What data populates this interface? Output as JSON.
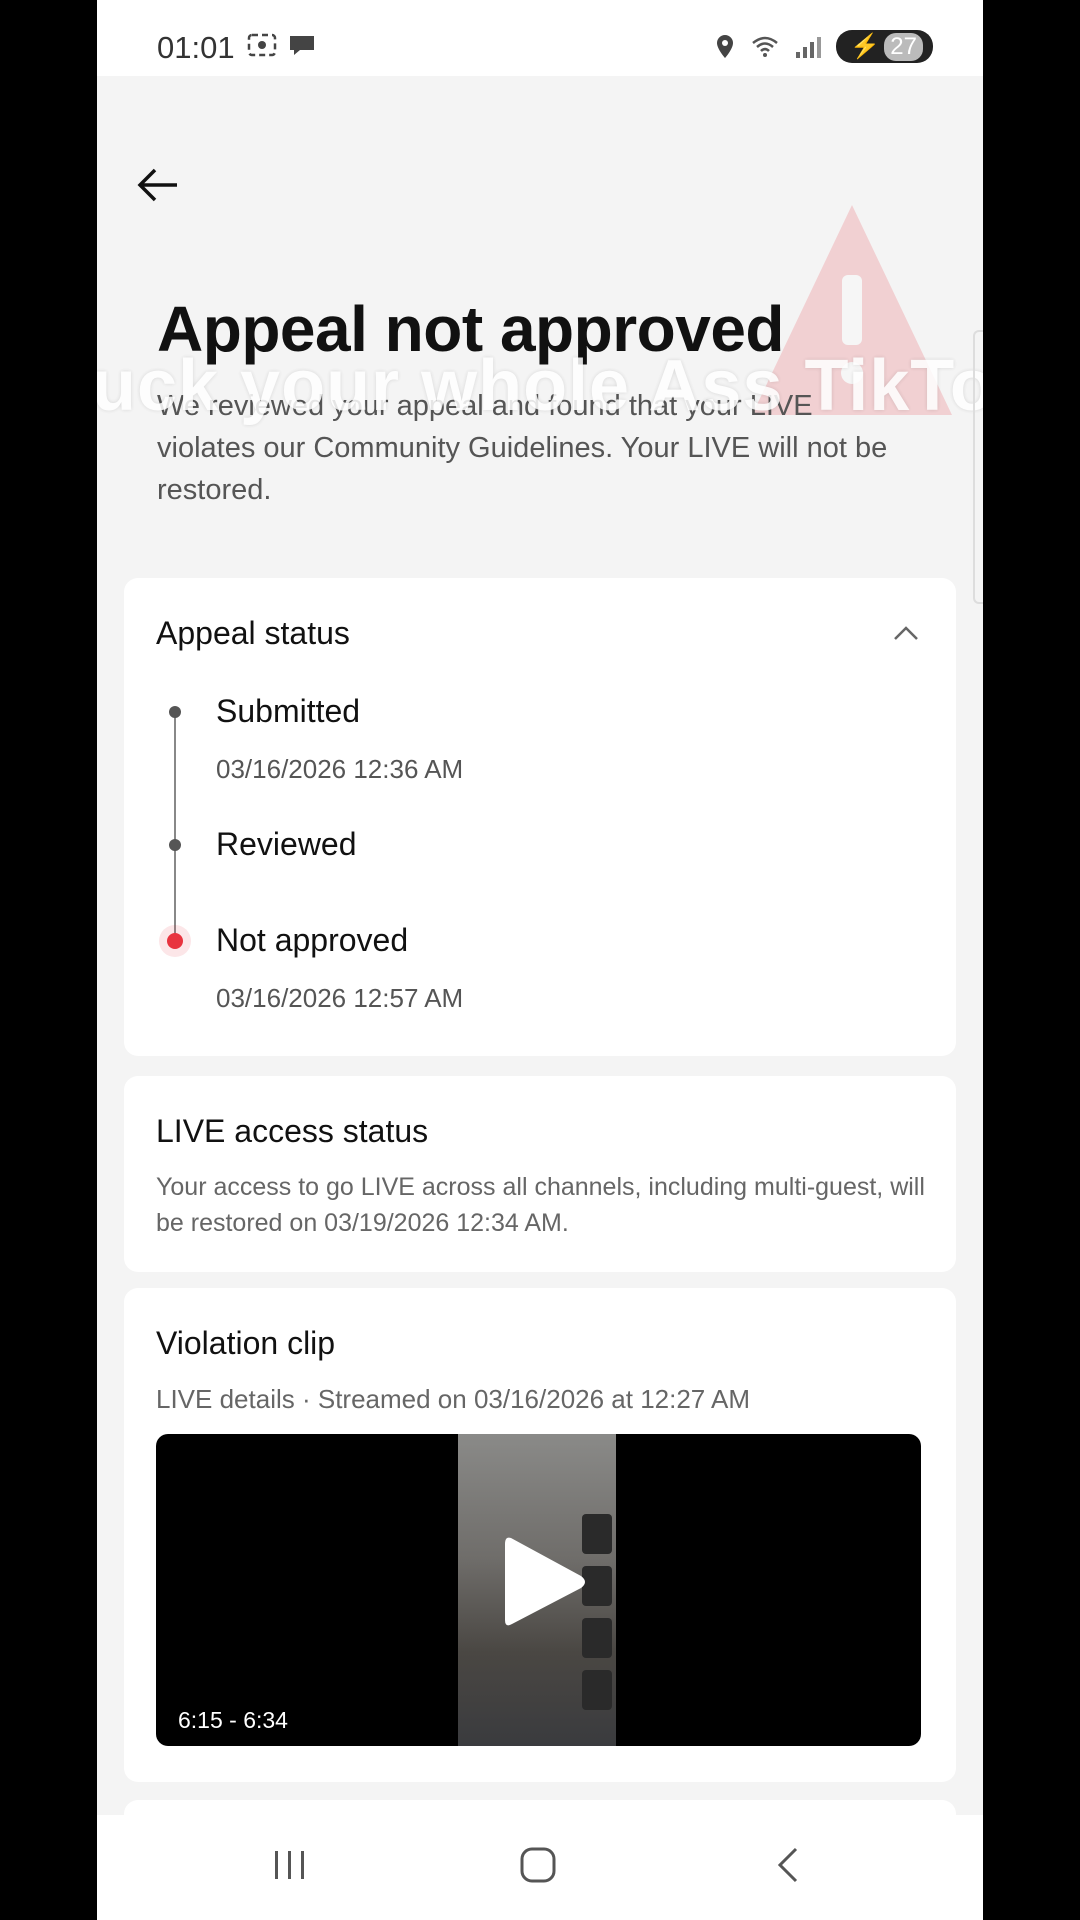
{
  "status_bar": {
    "time": "01:01",
    "battery": "27",
    "icons_left": [
      "screen-record-icon",
      "chat-bubble-icon"
    ],
    "icons_right": [
      "location-icon",
      "wifi-icon",
      "signal-icon",
      "battery-icon"
    ]
  },
  "overlay_caption": "Fuck your whole Ass TikTok",
  "header": {
    "title": "Appeal not approved",
    "description": "We reviewed your appeal and found that your LIVE violates our Community Guidelines. Your LIVE will not be restored."
  },
  "appeal_status": {
    "title": "Appeal status",
    "steps": [
      {
        "label": "Submitted",
        "date": "03/16/2026 12:36 AM"
      },
      {
        "label": "Reviewed",
        "date": ""
      },
      {
        "label": "Not approved",
        "date": "03/16/2026 12:57 AM"
      }
    ]
  },
  "live_access": {
    "title": "LIVE access status",
    "text": "Your access to go LIVE across all channels, including multi-guest, will be restored on 03/19/2026 12:34 AM."
  },
  "violation_clip": {
    "title": "Violation clip",
    "subtitle": "LIVE details · Streamed on 03/16/2026 at 12:27 AM",
    "time_range": "6:15 - 6:34"
  },
  "colors": {
    "accent_red": "#e8343f",
    "background": "#f4f4f4"
  }
}
